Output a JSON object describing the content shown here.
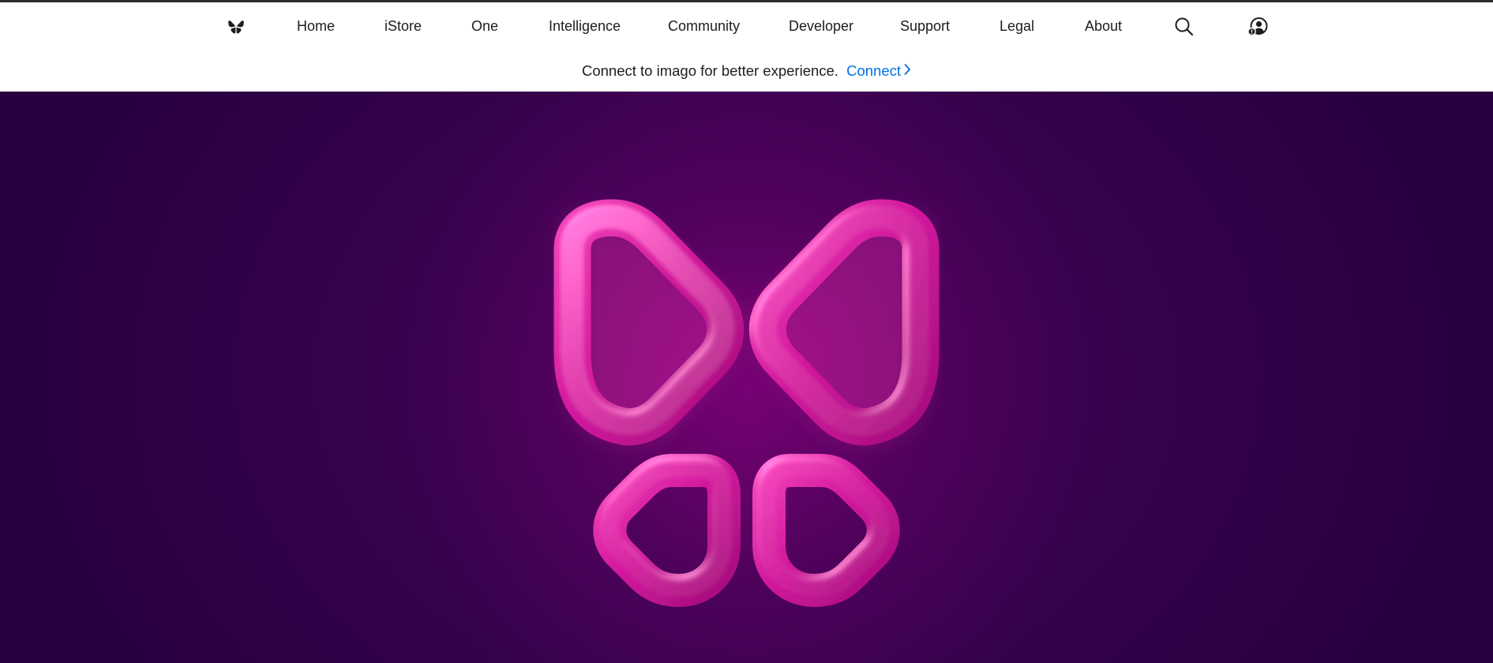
{
  "nav": {
    "logo_icon": "butterfly-logo-icon",
    "items": [
      {
        "label": "Home"
      },
      {
        "label": "iStore"
      },
      {
        "label": "One"
      },
      {
        "label": "Intelligence"
      },
      {
        "label": "Community"
      },
      {
        "label": "Developer"
      },
      {
        "label": "Support"
      },
      {
        "label": "Legal"
      },
      {
        "label": "About"
      }
    ],
    "search_icon": "search-icon",
    "account_icon": "account-icon"
  },
  "banner": {
    "text": "Connect to imago for better experience.",
    "link_label": "Connect",
    "link_color": "#0071e3"
  },
  "hero": {
    "logo_icon": "butterfly-hero-logo",
    "accent_color": "#d0189a",
    "background_color": "#2a0040"
  }
}
